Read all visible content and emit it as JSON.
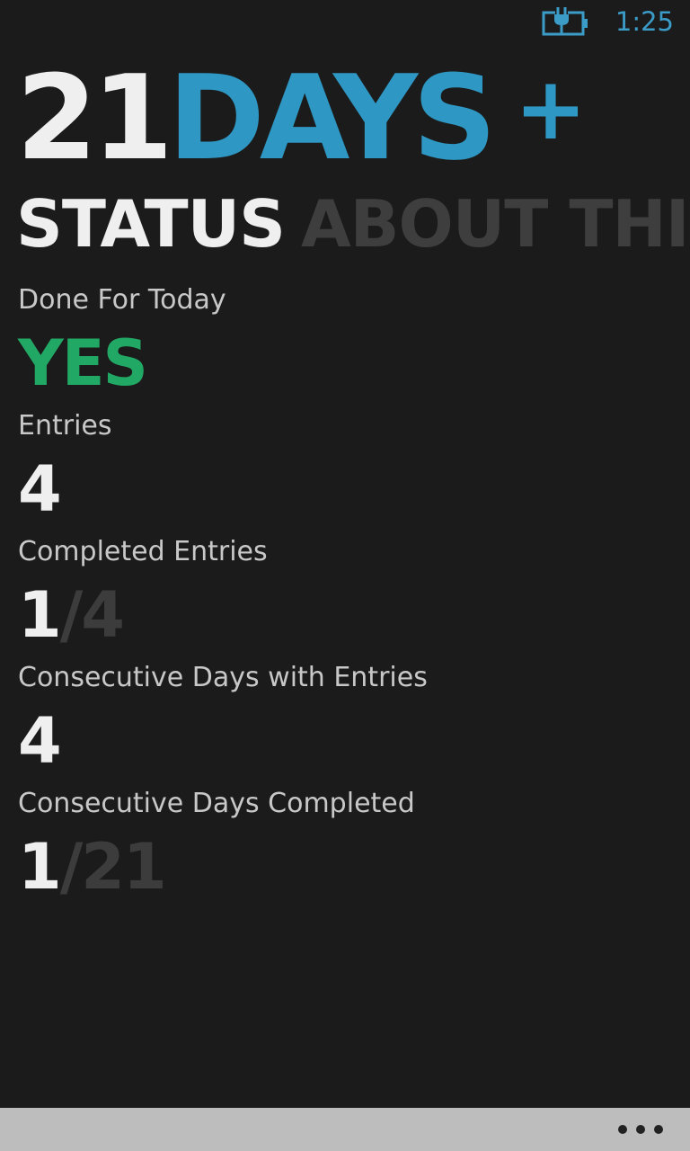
{
  "status_bar": {
    "time": "1:25",
    "battery_icon": "battery-charging-icon",
    "accent_color": "#3b9cc8"
  },
  "app_title": {
    "number": "21",
    "word": "DAYS",
    "suffix": "+"
  },
  "pivot": {
    "tabs": [
      {
        "label": "STATUS",
        "active": true
      },
      {
        "label": "ABOUT THI",
        "active": false
      }
    ]
  },
  "stats": {
    "done_today": {
      "label": "Done For Today",
      "value": "YES",
      "color": "#22a865"
    },
    "entries": {
      "label": "Entries",
      "value": "4"
    },
    "completed_entries": {
      "label": "Completed Entries",
      "value": "1",
      "total": "/4"
    },
    "consecutive_days_entries": {
      "label": "Consecutive Days with Entries",
      "value": "4"
    },
    "consecutive_days_completed": {
      "label": "Consecutive Days Completed",
      "value": "1",
      "total": "/21"
    }
  },
  "app_bar": {
    "more_icon": "ellipsis-icon"
  }
}
